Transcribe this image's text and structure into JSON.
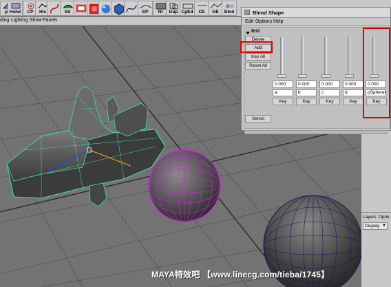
{
  "shelf": {
    "buttons": [
      {
        "label": "ph",
        "icon": "polygon-icon"
      },
      {
        "label": "Hshd",
        "icon": "shading-icon"
      },
      {
        "label": "CP",
        "icon": "control-point-icon"
      },
      {
        "label": "His",
        "icon": "history-icon"
      },
      {
        "label": "",
        "icon": "curve-icon"
      },
      {
        "label": "SS",
        "icon": "smooth-skin-icon"
      },
      {
        "label": "",
        "icon": "render-icon"
      },
      {
        "label": "",
        "icon": "red-block-icon"
      },
      {
        "label": "",
        "icon": "hypershade-icon"
      },
      {
        "label": "",
        "icon": "cube-icon"
      },
      {
        "label": "",
        "icon": "nurbs-icon"
      },
      {
        "label": "EP",
        "icon": "ep-curve-icon"
      },
      {
        "label": "Nt",
        "icon": "node-icon"
      },
      {
        "label": "Dup",
        "icon": "duplicate-icon"
      },
      {
        "label": "CpEd",
        "icon": "component-editor-icon"
      },
      {
        "label": "CE",
        "icon": "connection-editor-icon"
      },
      {
        "label": "GE",
        "icon": "graph-editor-icon"
      },
      {
        "label": "Blnd",
        "icon": "blend-icon"
      }
    ]
  },
  "viewport_menu": [
    "ding",
    "Lighting",
    "Show",
    "Panels"
  ],
  "blend_shape": {
    "title": "Blend Shape",
    "menu": [
      "Edit",
      "Options",
      "Help"
    ],
    "node": "test",
    "buttons": {
      "delete": "Delete",
      "add": "Add",
      "key_all": "Key All",
      "reset_all": "Reset All",
      "select": "Select"
    },
    "targets": [
      {
        "name": "a",
        "value": "0.000",
        "key": "Key"
      },
      {
        "name": "b",
        "value": "0.000",
        "key": "Key"
      },
      {
        "name": "c",
        "value": "0.000",
        "key": "Key"
      },
      {
        "name": "d",
        "value": "0.000",
        "key": "Key"
      },
      {
        "name": "pSphere6",
        "value": "0.000",
        "key": "Key"
      }
    ]
  },
  "layers": {
    "header": "Layers",
    "options": "Optio",
    "display": "Display"
  },
  "watermark": "MAYA特效吧 【www.linecg.com/tieba/1745】",
  "colors": {
    "ui_gray": "#c8c8c8",
    "viewport_bg": "#737373",
    "highlight_red": "#e00000",
    "selection_green": "#3ee6a0",
    "selection_magenta": "#d023d8",
    "wire_blue": "#1a1a5a"
  }
}
